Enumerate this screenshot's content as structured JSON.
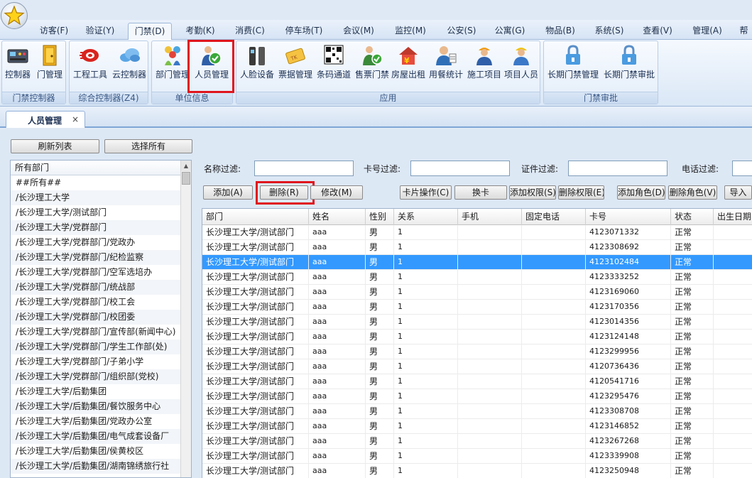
{
  "menu": {
    "tabs": [
      {
        "label": "访客(F)"
      },
      {
        "label": "验证(Y)"
      },
      {
        "label": "门禁(D)"
      },
      {
        "label": "考勤(K)"
      },
      {
        "label": "消费(C)"
      },
      {
        "label": "停车场(T)"
      },
      {
        "label": "会议(M)"
      },
      {
        "label": "监控(M)"
      },
      {
        "label": "公安(S)"
      },
      {
        "label": "公寓(G)"
      },
      {
        "label": "物品(B)"
      },
      {
        "label": "系统(S)"
      },
      {
        "label": "查看(V)"
      },
      {
        "label": "管理(A)"
      },
      {
        "label": "帮"
      }
    ],
    "active_tab": "门禁(D)"
  },
  "ribbon": {
    "groups": [
      {
        "label": "门禁控制器",
        "buttons": [
          {
            "label": "控制器",
            "icon": "controller-board-icon"
          },
          {
            "label": "门管理",
            "icon": "door-icon"
          }
        ]
      },
      {
        "label": "综合控制器(Z4)",
        "buttons": [
          {
            "label": "工程工具",
            "icon": "engineering-tool-icon"
          },
          {
            "label": "云控制器",
            "icon": "cloud-icon"
          }
        ]
      },
      {
        "label": "单位信息",
        "buttons": [
          {
            "label": "部门管理",
            "icon": "department-people-icon"
          },
          {
            "label": "人员管理",
            "icon": "personnel-check-icon"
          }
        ]
      },
      {
        "label": "应用",
        "buttons": [
          {
            "label": "人脸设备",
            "icon": "face-device-icon"
          },
          {
            "label": "票据管理",
            "icon": "ticket-icon"
          },
          {
            "label": "条码通道",
            "icon": "qr-code-icon"
          },
          {
            "label": "售票门禁",
            "icon": "ticket-gate-icon"
          },
          {
            "label": "房屋出租",
            "icon": "house-rent-icon"
          },
          {
            "label": "用餐统计",
            "icon": "dining-stats-icon"
          },
          {
            "label": "施工项目",
            "icon": "construction-worker-icon"
          },
          {
            "label": "项目人员",
            "icon": "project-staff-icon"
          }
        ]
      },
      {
        "label": "门禁审批",
        "buttons": [
          {
            "label": "长期门禁管理",
            "icon": "lock-icon"
          },
          {
            "label": "长期门禁审批",
            "icon": "lock-icon"
          }
        ]
      }
    ]
  },
  "doc_tab": {
    "label": "人员管理",
    "close": "×"
  },
  "left": {
    "refresh_label": "刷新列表",
    "select_all_label": "选择所有",
    "dept_header": "所有部门",
    "departments": [
      "##所有##",
      "/长沙理工大学",
      "/长沙理工大学/测试部门",
      "/长沙理工大学/党群部门",
      "/长沙理工大学/党群部门/党政办",
      "/长沙理工大学/党群部门/纪检监察",
      "/长沙理工大学/党群部门/空军选培办",
      "/长沙理工大学/党群部门/统战部",
      "/长沙理工大学/党群部门/校工会",
      "/长沙理工大学/党群部门/校团委",
      "/长沙理工大学/党群部门/宣传部(新闻中心)",
      "/长沙理工大学/党群部门/学生工作部(处)",
      "/长沙理工大学/党群部门/子弟小学",
      "/长沙理工大学/党群部门/组织部(党校)",
      "/长沙理工大学/后勤集团",
      "/长沙理工大学/后勤集团/餐饮服务中心",
      "/长沙理工大学/后勤集团/党政办公室",
      "/长沙理工大学/后勤集团/电气成套设备厂",
      "/长沙理工大学/后勤集团/侯黄校区",
      "/长沙理工大学/后勤集团/湖南锦绣旅行社"
    ]
  },
  "filters": {
    "name_label": "名称过滤:",
    "card_label": "卡号过滤:",
    "id_label": "证件过滤:",
    "phone_label": "电话过滤:"
  },
  "actions": {
    "add": "添加(A)",
    "delete": "删除(R)",
    "edit": "修改(M)",
    "card_op": "卡片操作(C)",
    "swap_card": "换卡",
    "add_perm": "添加权限(S)",
    "del_perm": "删除权限(E)",
    "add_role": "添加角色(D)",
    "del_role": "删除角色(V)",
    "import": "导入"
  },
  "table": {
    "columns": [
      "部门",
      "姓名",
      "性别",
      "关系",
      "手机",
      "固定电话",
      "卡号",
      "状态",
      "出生日期"
    ],
    "selected_index": 2,
    "rows": [
      [
        "长沙理工大学/测试部门",
        "aaa",
        "男",
        "1",
        "",
        "",
        "4123071332",
        "正常",
        ""
      ],
      [
        "长沙理工大学/测试部门",
        "aaa",
        "男",
        "1",
        "",
        "",
        "4123308692",
        "正常",
        ""
      ],
      [
        "长沙理工大学/测试部门",
        "aaa",
        "男",
        "1",
        "",
        "",
        "4123102484",
        "正常",
        ""
      ],
      [
        "长沙理工大学/测试部门",
        "aaa",
        "男",
        "1",
        "",
        "",
        "4123333252",
        "正常",
        ""
      ],
      [
        "长沙理工大学/测试部门",
        "aaa",
        "男",
        "1",
        "",
        "",
        "4123169060",
        "正常",
        ""
      ],
      [
        "长沙理工大学/测试部门",
        "aaa",
        "男",
        "1",
        "",
        "",
        "4123170356",
        "正常",
        ""
      ],
      [
        "长沙理工大学/测试部门",
        "aaa",
        "男",
        "1",
        "",
        "",
        "4123014356",
        "正常",
        ""
      ],
      [
        "长沙理工大学/测试部门",
        "aaa",
        "男",
        "1",
        "",
        "",
        "4123124148",
        "正常",
        ""
      ],
      [
        "长沙理工大学/测试部门",
        "aaa",
        "男",
        "1",
        "",
        "",
        "4123299956",
        "正常",
        ""
      ],
      [
        "长沙理工大学/测试部门",
        "aaa",
        "男",
        "1",
        "",
        "",
        "4120736436",
        "正常",
        ""
      ],
      [
        "长沙理工大学/测试部门",
        "aaa",
        "男",
        "1",
        "",
        "",
        "4120541716",
        "正常",
        ""
      ],
      [
        "长沙理工大学/测试部门",
        "aaa",
        "男",
        "1",
        "",
        "",
        "4123295476",
        "正常",
        ""
      ],
      [
        "长沙理工大学/测试部门",
        "aaa",
        "男",
        "1",
        "",
        "",
        "4123308708",
        "正常",
        ""
      ],
      [
        "长沙理工大学/测试部门",
        "aaa",
        "男",
        "1",
        "",
        "",
        "4123146852",
        "正常",
        ""
      ],
      [
        "长沙理工大学/测试部门",
        "aaa",
        "男",
        "1",
        "",
        "",
        "4123267268",
        "正常",
        ""
      ],
      [
        "长沙理工大学/测试部门",
        "aaa",
        "男",
        "1",
        "",
        "",
        "4123339908",
        "正常",
        ""
      ],
      [
        "长沙理工大学/测试部门",
        "aaa",
        "男",
        "1",
        "",
        "",
        "4123250948",
        "正常",
        ""
      ]
    ]
  },
  "colors": {
    "selection": "#3399ff",
    "highlight_box": "#e0161d",
    "ribbon_text": "#1b2f52"
  }
}
